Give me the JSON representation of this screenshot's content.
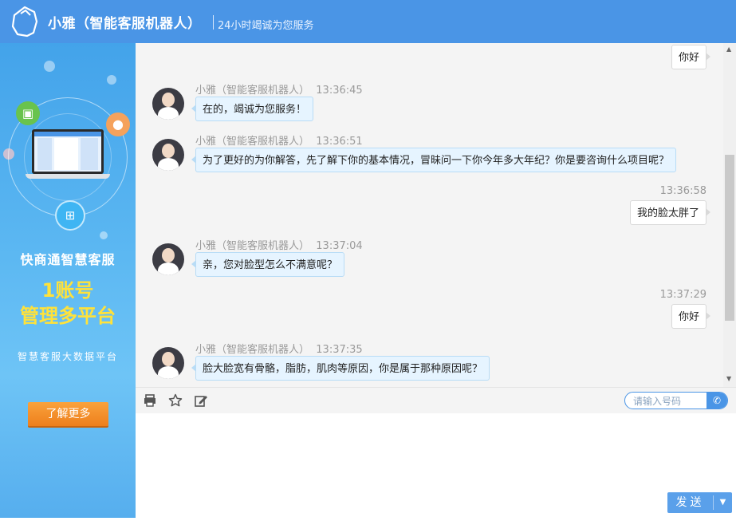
{
  "header": {
    "title": "小雅（智能客服机器人）",
    "subtitle": "24小时竭诚为您服务"
  },
  "sidebar": {
    "promo_line1": "快商通智慧客服",
    "promo_line2a": "1账号",
    "promo_line2b": "管理多平台",
    "promo_line3": "智慧客服大数据平台",
    "learn_more": "了解更多"
  },
  "messages": [
    {
      "from": "user",
      "time": "",
      "text": "你好"
    },
    {
      "from": "bot",
      "sender": "小雅（智能客服机器人）",
      "time": "13:36:45",
      "text": "在的，竭诚为您服务！"
    },
    {
      "from": "bot",
      "sender": "小雅（智能客服机器人）",
      "time": "13:36:51",
      "text": "为了更好的为你解答，先了解下你的基本情况，冒昧问一下你今年多大年纪？你是要咨询什么项目呢？"
    },
    {
      "from": "user",
      "time": "13:36:58",
      "text": "我的脸太胖了"
    },
    {
      "from": "bot",
      "sender": "小雅（智能客服机器人）",
      "time": "13:37:04",
      "text": "亲，您对脸型怎么不满意呢？"
    },
    {
      "from": "user",
      "time": "13:37:29",
      "text": "你好"
    },
    {
      "from": "bot",
      "sender": "小雅（智能客服机器人）",
      "time": "13:37:35",
      "text": "脸大脸宽有骨骼，脂肪，肌肉等原因，你是属于那种原因呢？"
    }
  ],
  "toolbar": {
    "phone_placeholder": "请输入号码",
    "icons": [
      "print-icon",
      "star-icon",
      "edit-icon",
      "phone-icon"
    ]
  },
  "composer": {
    "send_label": "发送"
  },
  "colors": {
    "brand": "#4a95e6",
    "bot_bubble": "#e6f4ff",
    "promo_yellow": "#ffe23a",
    "button_orange": "#f39030"
  }
}
